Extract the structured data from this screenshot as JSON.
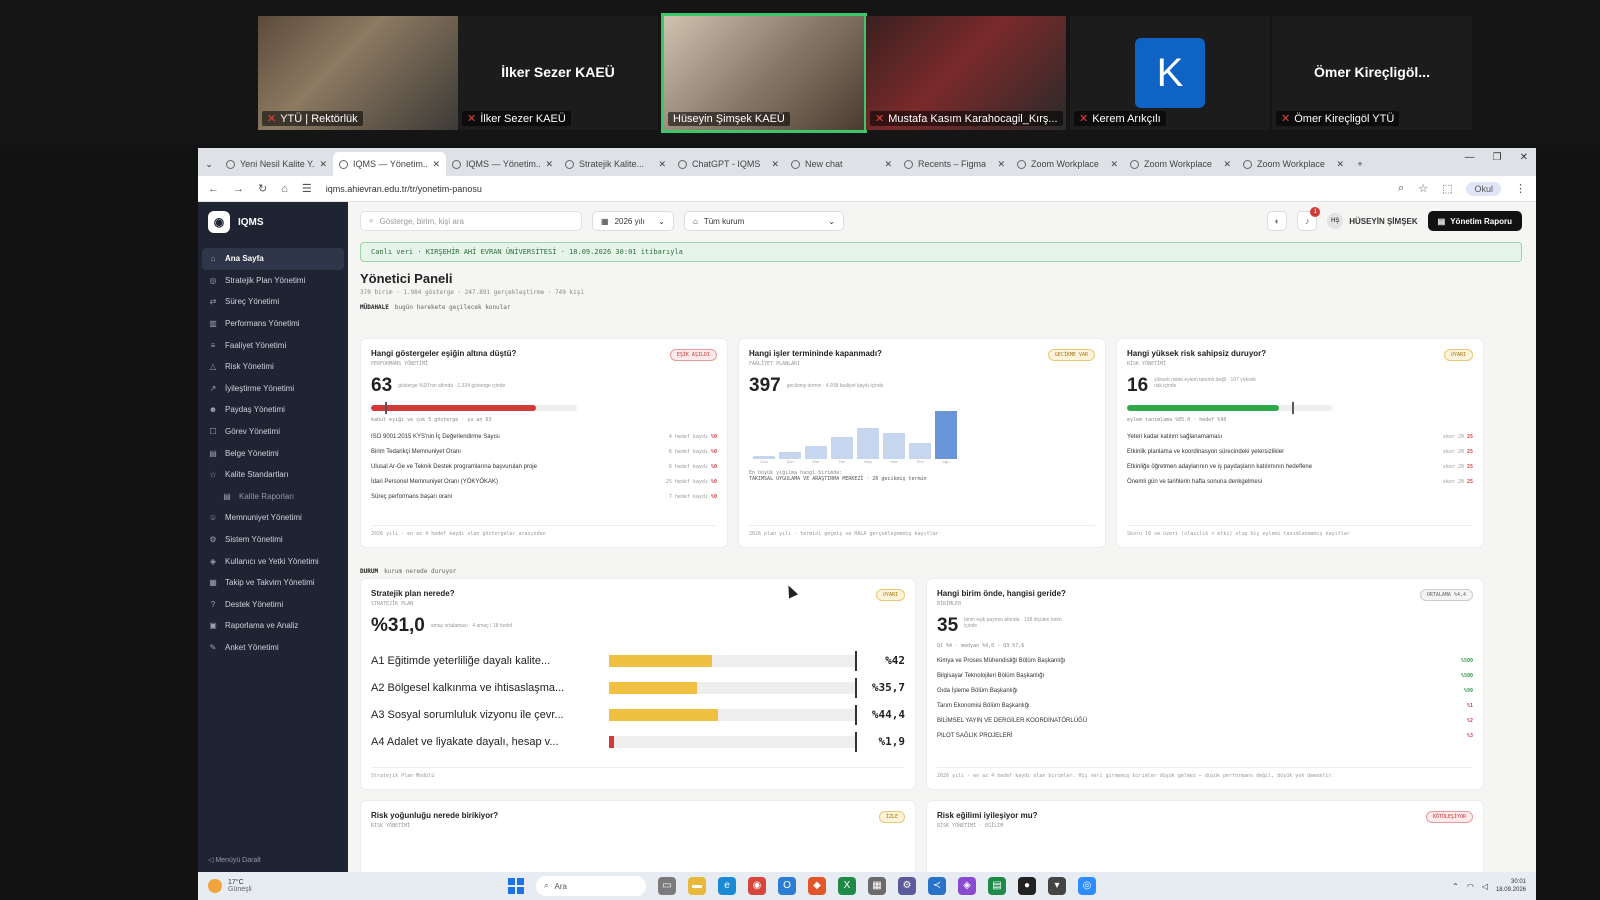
{
  "meeting": {
    "participants": [
      {
        "label": "YTÜ | Rektörlük",
        "type": "video"
      },
      {
        "label": "İlker Sezer KAEÜ",
        "big": "İlker Sezer KAEÜ",
        "type": "name"
      },
      {
        "label": "Hüseyin Şimşek KAEÜ",
        "type": "video",
        "active": true
      },
      {
        "label": "Mustafa Kasım Karahocagil_Kırş...",
        "type": "video"
      },
      {
        "label": "Kerem Arıkçılı",
        "type": "avatar",
        "initial": "K"
      },
      {
        "label": "Ömer Kireçligöl YTÜ",
        "big": "Ömer Kireçligöl...",
        "type": "name"
      }
    ]
  },
  "browser": {
    "tabs": [
      {
        "label": "Yeni Nesil Kalite Y..."
      },
      {
        "label": "IQMS — Yönetim...",
        "active": true
      },
      {
        "label": "IQMS — Yönetim..."
      },
      {
        "label": "Stratejik Kalite..."
      },
      {
        "label": "ChatGPT - IQMS"
      },
      {
        "label": "New chat"
      },
      {
        "label": "Recents – Figma"
      },
      {
        "label": "Zoom Workplace"
      },
      {
        "label": "Zoom Workplace"
      },
      {
        "label": "Zoom Workplace"
      }
    ],
    "url": "iqms.ahievran.edu.tr/tr/yonetim-panosu",
    "profile": "Okul"
  },
  "sidebar": {
    "brand": "IQMS",
    "items": [
      {
        "label": "Ana Sayfa",
        "icon": "⌂",
        "active": true
      },
      {
        "label": "Stratejik Plan Yönetimi",
        "icon": "◎"
      },
      {
        "label": "Süreç Yönetimi",
        "icon": "⇄"
      },
      {
        "label": "Performans Yönetimi",
        "icon": "▥"
      },
      {
        "label": "Faaliyet Yönetimi",
        "icon": "≡"
      },
      {
        "label": "Risk Yönetimi",
        "icon": "△"
      },
      {
        "label": "İyileştirme Yönetimi",
        "icon": "↗"
      },
      {
        "label": "Paydaş Yönetimi",
        "icon": "☻"
      },
      {
        "label": "Görev Yönetimi",
        "icon": "☐"
      },
      {
        "label": "Belge Yönetimi",
        "icon": "▤"
      },
      {
        "label": "Kalite Standartları",
        "icon": "☆"
      },
      {
        "label": "Kalite Raporları",
        "icon": "▤",
        "sub": true
      },
      {
        "label": "Memnuniyet Yönetimi",
        "icon": "☺"
      },
      {
        "label": "Sistem Yönetimi",
        "icon": "⚙"
      },
      {
        "label": "Kullanıcı ve Yetki Yönetimi",
        "icon": "◈"
      },
      {
        "label": "Takip ve Takvim Yönetimi",
        "icon": "▦"
      },
      {
        "label": "Destek Yönetimi",
        "icon": "?"
      },
      {
        "label": "Raporlama ve Analiz",
        "icon": "▣"
      },
      {
        "label": "Anket Yönetimi",
        "icon": "✎"
      }
    ],
    "collapse": "Menüyü Daralt"
  },
  "topbar": {
    "search_placeholder": "Gösterge, birim, kişi ara",
    "year": "2026 yılı",
    "org": "Tüm kurum",
    "user_initials": "HŞ",
    "user_name": "HÜSEYİN ŞİMŞEK",
    "report_button": "Yönetim Raporu",
    "notification_count": "1"
  },
  "page": {
    "live": "Canlı veri · KIRŞEHİR AHİ EVRAN ÜNİVERSİTESİ · 18.09.2026 30:01 itibarıyla",
    "title": "Yönetici Paneli",
    "subtitle": "370 birim · 1.984 gösterge · 247.891 gerçekleştirme · 749 kişi",
    "section1_title": "MÜDAHALE",
    "section1_sub": "bugün harekete geçilecek konular",
    "section2_title": "DURUM",
    "section2_sub": "kurum nerede duruyor"
  },
  "cards": {
    "c1": {
      "title": "Hangi göstergeler eşiğin altına düştü?",
      "sub": "PERFORMANS YÖNETİMİ",
      "tag": "EŞİK AŞILDI",
      "value": "63",
      "note": "gösterge %20'nin altında · 1.334 gösterge içinde",
      "fill_pct": 80,
      "marker_pct": 7,
      "bar_caption": "kabul eşiği ve çok 5 gösterge · şu an 63",
      "rows": [
        {
          "label": "ISO 9001:2015 KYS'nin İç Değerlendirme Sayısı",
          "meta": "4 hedef kaydı",
          "value": "%0"
        },
        {
          "label": "Birim Tedarikçi Memnuniyet Oranı",
          "meta": "6 hedef kaydı",
          "value": "%0"
        },
        {
          "label": "Ulusal Ar-Ge ve Teknik Destek programlarına başvurulan proje",
          "meta": "6 hedef kaydı",
          "value": "%0"
        },
        {
          "label": "İdari Personel Memnuniyet Oranı (YÖKYÖKAK)",
          "meta": "25 hedef kaydı",
          "value": "%0"
        },
        {
          "label": "Süreç performans başarı oranı",
          "meta": "7 hedef kaydı",
          "value": "%0"
        }
      ],
      "footer": "2026 yılı · en az 4 hedef kaydı olan göstergeler arasından"
    },
    "c2": {
      "title": "Hangi işler termininde kapanmadı?",
      "sub": "FAALİYET PLANLARI",
      "tag": "GECİKME VAR",
      "value": "397",
      "note": "gecikmiş termin · 4.938 faaliyet kaydı içinde",
      "months": [
        "Oca",
        "Şub",
        "Mar",
        "Nis",
        "May",
        "Haz",
        "Tem",
        "Ağu"
      ],
      "bar_values": [
        4,
        10,
        18,
        30,
        42,
        36,
        22,
        66
      ],
      "caption1": "En büyük yığılma hangi birimde:",
      "caption2": "TAKIMSAL UYGULAMA VE ARAŞTIRMA MERKEZİ · 26 gecikmiş termin",
      "footer": "2026 plan yılı · termini geçmiş ve HALA gerçekleşmemiş kayıtlar"
    },
    "c3": {
      "title": "Hangi yüksek risk sahipsiz duruyor?",
      "sub": "RİSK YÖNETİMİ",
      "tag": "UYARI",
      "value": "16",
      "note": "yüksek riskte eylem tanımlı değil · 107 yüksek risk içinde",
      "fill_pct": 74,
      "marker_pct": 80,
      "bar_caption": "eylem tanımlama %85.0 · hedef %90",
      "rows": [
        {
          "label": "Yeteri kadar katılım sağlanamaması",
          "meta": "skor 20",
          "value": "25"
        },
        {
          "label": "Etkinlik planlama ve koordinasyon sürecindeki yetersizlikler",
          "meta": "skor 20",
          "value": "25"
        },
        {
          "label": "Etkinliğe öğretmen adaylarının ve iş paydaşların katılımının hedeflene",
          "meta": "skor 20",
          "value": "25"
        },
        {
          "label": "Önemli gün ve tarihlerin hafta sonuna denkgelmesi",
          "meta": "skor 20",
          "value": "25"
        }
      ],
      "footer": "Skoru 16 ve üzeri (olasılık × etki) olup hiç eylemi tanımlanmamış kayıtlar"
    },
    "c4": {
      "title": "Stratejik plan nerede?",
      "sub": "STRATEJİK PLAN",
      "tag": "UYARI",
      "value": "%31,0",
      "note": "amaç ortalaması · 4 amaç / 18 hedef",
      "rows": [
        {
          "label": "A1 Eğitimde yeterliliğe dayalı kalite...",
          "fill": 42,
          "value": "%42"
        },
        {
          "label": "A2 Bölgesel kalkınma ve ihtisaslaşma...",
          "fill": 35.7,
          "value": "%35,7"
        },
        {
          "label": "A3 Sosyal sorumluluk vizyonu ile çevr...",
          "fill": 44.4,
          "value": "%44,4"
        },
        {
          "label": "A4 Adalet ve liyakate dayalı, hesap v...",
          "fill": 1.9,
          "value": "%1,9",
          "low": true
        }
      ],
      "footer": "Stratejik Plan Modülü"
    },
    "c5": {
      "title": "Hangi birim önde, hangisi geride?",
      "sub": "BİRİMLER",
      "tag": "ORTALAMA %4,4",
      "value": "35",
      "note": "birim eşik payının altında · 138 ölçülen birim içinde",
      "stats": "Q1 %4 · medyan %4,0 · Q3 %7,6",
      "rows": [
        {
          "label": "Kimya ve Proses Mühendisliği Bölüm Başkanlığı",
          "value": "%500",
          "good": true
        },
        {
          "label": "Bilgisayar Teknolojileri Bölüm Başkanlığı",
          "value": "%500",
          "good": true
        },
        {
          "label": "Gıda İşleme Bölüm Başkanlığı",
          "value": "%99",
          "good": true
        },
        {
          "label": "Tarım Ekonomisi Bölüm Başkanlığı",
          "value": "%1"
        },
        {
          "label": "BİLİMSEL YAYIN VE DERGİLER KOORDİNATÖRLÜĞÜ",
          "value": "%2"
        },
        {
          "label": "PILOT SAĞLIK PROJELERİ",
          "value": "%3"
        }
      ],
      "footer": "2026 yılı · en az 4 hedef kaydı olan birimler. Hiç veri girmemiş birimler düşük gelmez — düşük performans değil, düşük yok demektir."
    },
    "c6": {
      "title": "Risk yoğunluğu nerede birikiyor?",
      "sub": "RİSK YÖNETİMİ",
      "tag": "İZLE"
    },
    "c7": {
      "title": "Risk eğilimi iyileşiyor mu?",
      "sub": "RİSK YÖNETİMİ · EĞİLİM",
      "tag": "KÖTÜLEŞİYOR"
    }
  },
  "taskbar": {
    "temp": "17°C",
    "weather": "Güneşli",
    "search": "Ara",
    "time": "30:01",
    "date": "18.09.2026"
  }
}
